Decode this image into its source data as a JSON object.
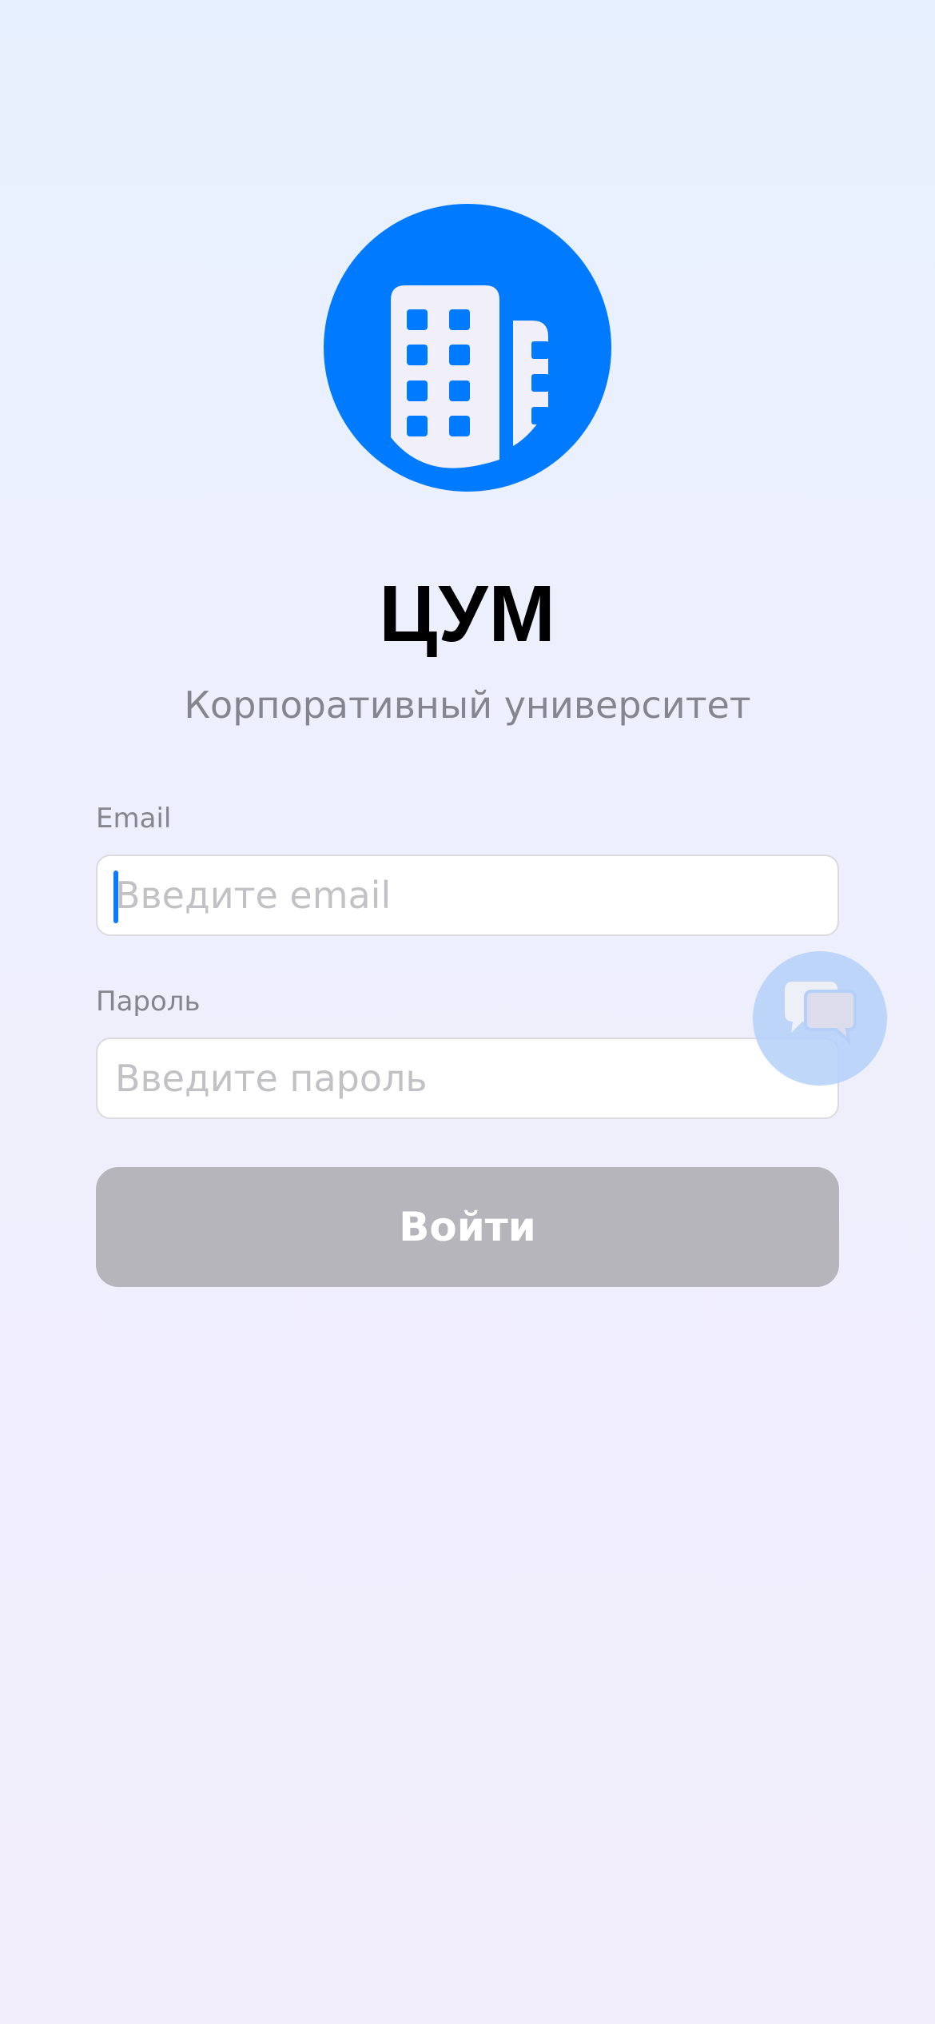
{
  "app": {
    "title": "ЦУМ",
    "subtitle": "Корпоративный университет",
    "logo_icon": "building-icon",
    "brand_color": "#007AFF"
  },
  "form": {
    "email": {
      "label": "Email",
      "value": "",
      "placeholder": "Введите email",
      "focused": true
    },
    "password": {
      "label": "Пароль",
      "value": "",
      "placeholder": "Введите пароль"
    },
    "submit": {
      "label": "Войти",
      "enabled": false,
      "color": "#B6B5BC"
    }
  },
  "chat": {
    "icon": "chat-bubbles-icon"
  }
}
